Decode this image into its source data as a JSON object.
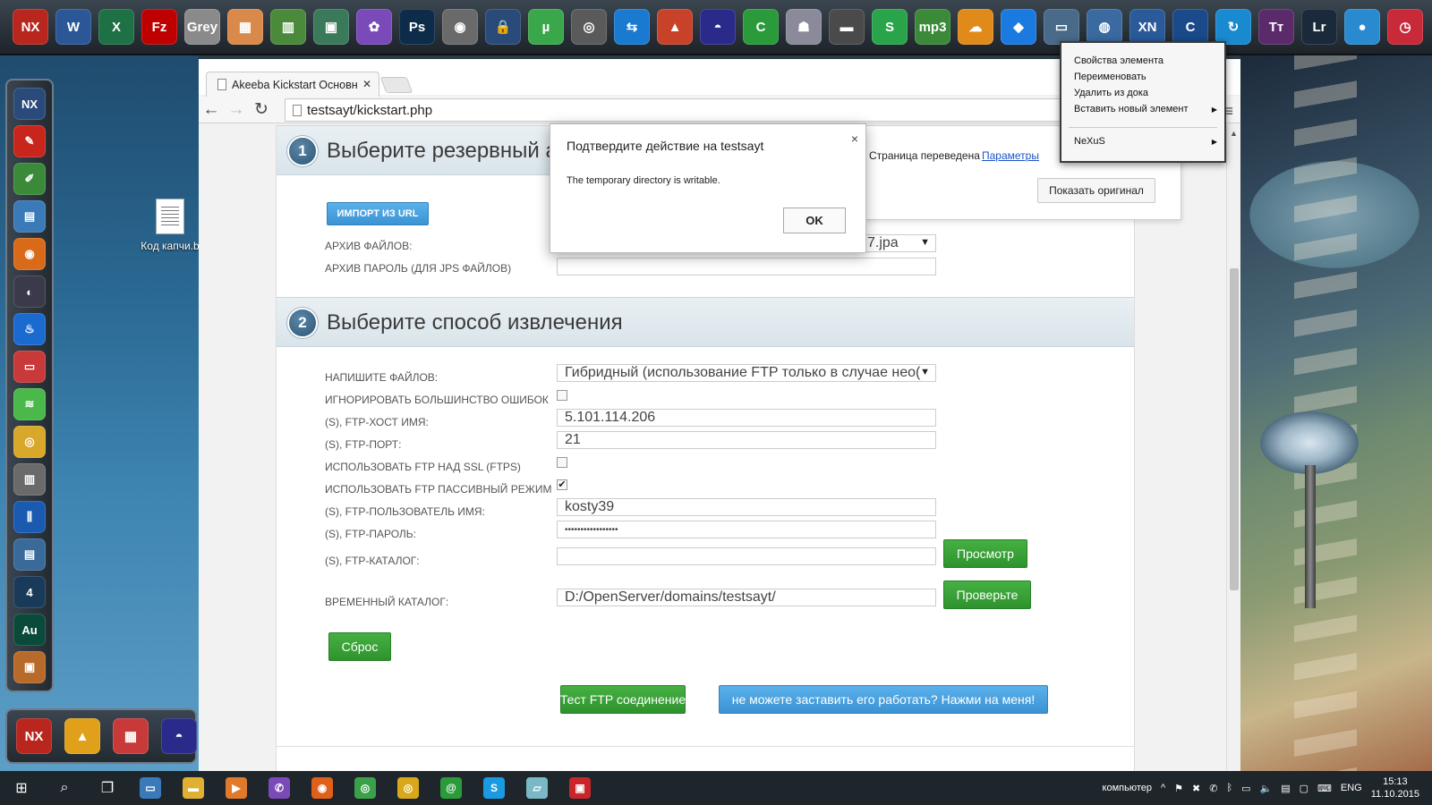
{
  "desktop": {
    "file_label": "Код капчи.b"
  },
  "top_dock": {
    "icons": [
      {
        "name": "nexus-icon",
        "glyph": "NX",
        "color": "#b8261d"
      },
      {
        "name": "word-icon",
        "glyph": "W",
        "color": "#2b5797"
      },
      {
        "name": "excel-icon",
        "glyph": "X",
        "color": "#1e7145"
      },
      {
        "name": "filezilla-icon",
        "glyph": "Fz",
        "color": "#bf0000"
      },
      {
        "name": "grey-icon",
        "glyph": "Grey",
        "color": "#8a8a8a"
      },
      {
        "name": "archive-icon",
        "glyph": "▦",
        "color": "#d98a4a"
      },
      {
        "name": "calculator-icon",
        "glyph": "▥",
        "color": "#4a8a3a"
      },
      {
        "name": "photo-viewer-icon",
        "glyph": "▣",
        "color": "#3a7a5a"
      },
      {
        "name": "picasa-icon",
        "glyph": "✿",
        "color": "#7a4ab8"
      },
      {
        "name": "photoshop-icon",
        "glyph": "Ps",
        "color": "#0c2c4a"
      },
      {
        "name": "disc-icon",
        "glyph": "◉",
        "color": "#6a6a6a"
      },
      {
        "name": "lock-icon",
        "glyph": "🔒",
        "color": "#2a4a7a"
      },
      {
        "name": "utorrent-icon",
        "glyph": "µ",
        "color": "#3aa84a"
      },
      {
        "name": "webcam-icon",
        "glyph": "◎",
        "color": "#5a5a5a"
      },
      {
        "name": "teamviewer-icon",
        "glyph": "⇆",
        "color": "#1a7ad0"
      },
      {
        "name": "antivirus-icon",
        "glyph": "▲",
        "color": "#c8422a"
      },
      {
        "name": "helmet-icon",
        "glyph": "◓",
        "color": "#2a2a8a"
      },
      {
        "name": "camtasia-icon",
        "glyph": "C",
        "color": "#2a9a3a"
      },
      {
        "name": "robot-icon",
        "glyph": "☗",
        "color": "#8a8a9a"
      },
      {
        "name": "memory-icon",
        "glyph": "▬",
        "color": "#4a4a4a"
      },
      {
        "name": "skype-s-icon",
        "glyph": "S",
        "color": "#2aa44a"
      },
      {
        "name": "mp3-cutter-icon",
        "glyph": "mp3",
        "color": "#3a8a3a"
      },
      {
        "name": "weather-icon",
        "glyph": "☁",
        "color": "#e08a1a"
      },
      {
        "name": "dropbox-icon",
        "glyph": "◆",
        "color": "#1a7ae0"
      },
      {
        "name": "screen-icon",
        "glyph": "▭",
        "color": "#4a6a8a"
      },
      {
        "name": "globe-icon",
        "glyph": "◍",
        "color": "#3a6aa0"
      },
      {
        "name": "xn-icon",
        "glyph": "XN",
        "color": "#2a5a9a"
      },
      {
        "name": "browser-c-icon",
        "glyph": "C",
        "color": "#1a4a8a"
      },
      {
        "name": "sync-icon",
        "glyph": "↻",
        "color": "#1a8ad0"
      },
      {
        "name": "typora-icon",
        "glyph": "Tт",
        "color": "#5a2a6a"
      },
      {
        "name": "lightroom-icon",
        "glyph": "Lr",
        "color": "#1a2a3a"
      },
      {
        "name": "bubble-icon",
        "glyph": "●",
        "color": "#2a8ad0"
      },
      {
        "name": "alarm-clock-icon",
        "glyph": "◷",
        "color": "#c82a3a"
      }
    ]
  },
  "left_dock": {
    "icons": [
      {
        "name": "nexus-small-icon",
        "glyph": "NX",
        "color": "#2a4a7a"
      },
      {
        "name": "feather-icon",
        "glyph": "✎",
        "color": "#c8261d"
      },
      {
        "name": "notepad-icon",
        "glyph": "✐",
        "color": "#3a8a3a"
      },
      {
        "name": "landscape-icon",
        "glyph": "▤",
        "color": "#3a7ab8"
      },
      {
        "name": "eye-icon",
        "glyph": "◉",
        "color": "#d86a1a"
      },
      {
        "name": "eye-dark-icon",
        "glyph": "◐",
        "color": "#3a3a4a"
      },
      {
        "name": "fire-icon",
        "glyph": "♨",
        "color": "#1a6ad0"
      },
      {
        "name": "card-icon",
        "glyph": "▭",
        "color": "#c83a3a"
      },
      {
        "name": "wifi-icon",
        "glyph": "≋",
        "color": "#4ab84a"
      },
      {
        "name": "coins-icon",
        "glyph": "◎",
        "color": "#d8a82a"
      },
      {
        "name": "server-icon",
        "glyph": "▥",
        "color": "#6a6a6a"
      },
      {
        "name": "equalizer-icon",
        "glyph": "⫼",
        "color": "#1a5ab0"
      },
      {
        "name": "documents-icon",
        "glyph": "▤",
        "color": "#3a6a9a"
      },
      {
        "name": "four-icon",
        "glyph": "4",
        "color": "#1a3a5a"
      },
      {
        "name": "audition-icon",
        "glyph": "Au",
        "color": "#0a4a3a"
      },
      {
        "name": "toolbox-icon",
        "glyph": "▣",
        "color": "#b86a2a"
      }
    ]
  },
  "bottom_dock": {
    "icons": [
      {
        "name": "nexus-bottom-icon",
        "glyph": "NX",
        "color": "#b8261d"
      },
      {
        "name": "triangle-icon",
        "glyph": "▲",
        "color": "#e0a01a"
      },
      {
        "name": "cube-icon",
        "glyph": "▦",
        "color": "#c83a3a"
      },
      {
        "name": "helmet-bottom-icon",
        "glyph": "◓",
        "color": "#2a2a8a"
      }
    ]
  },
  "browser": {
    "tab_title": "Akeeba Kickstart Основн",
    "url": "testsayt/kickstart.php"
  },
  "page": {
    "section1": {
      "number": "1",
      "title": "Выберите резервный а",
      "import_button": "ИМПОРТ ИЗ URL",
      "archive_label": "АРХИВ ФАЙЛОВ:",
      "archive_value": "7.jpa",
      "password_label": "АРХИВ ПАРОЛЬ (ДЛЯ JPS ФАЙЛОВ)"
    },
    "section2": {
      "number": "2",
      "title": "Выберите способ извлечения",
      "write_label": "НАПИШИТЕ ФАЙЛОВ:",
      "write_value": "Гибридный (использование FTP только в случае нео(",
      "ignore_label": "ИГНОРИРОВАТЬ БОЛЬШИНСТВО ОШИБОК",
      "ftp_host_label": "(S), FTP-ХОСТ ИМЯ:",
      "ftp_host_value": "5.101.114.206",
      "ftp_port_label": "(S), FTP-ПОРТ:",
      "ftp_port_value": "21",
      "ftps_label": "ИСПОЛЬЗОВАТЬ FTP НАД SSL (FTPS)",
      "passive_label": "ИСПОЛЬЗОВАТЬ FTP ПАССИВНЫЙ РЕЖИМ",
      "passive_check": "✔",
      "ftp_user_label": "(S), FTP-ПОЛЬЗОВАТЕЛЬ ИМЯ:",
      "ftp_user_value": "kosty39",
      "ftp_pass_label": "(S), FTP-ПАРОЛЬ:",
      "ftp_pass_value": "•••••••••••••••••",
      "ftp_dir_label": "(S), FTP-КАТАЛОГ:",
      "browse_button": "Просмотр",
      "temp_label": "ВРЕМЕННЫЙ КАТАЛОГ:",
      "temp_value": "D:/OpenServer/domains/testsayt/",
      "check_button": "Проверьте",
      "reset_button": "Сброс",
      "test_ftp_button": "Тест FTP соединение",
      "help_button": "не можете заставить его работать? Нажми на меня!"
    }
  },
  "translate_bar": {
    "text": "Страница переведена",
    "link": "Параметры",
    "show_original": "Показать оригинал"
  },
  "dialog": {
    "title": "Подтвердите действие на testsayt",
    "message": "The temporary directory is writable.",
    "ok": "OK",
    "close": "×"
  },
  "context_menu": {
    "items": [
      "Свойства элемента",
      "Переименовать",
      "Удалить из дока",
      "Вставить новый элемент",
      "NeXuS"
    ]
  },
  "taskbar": {
    "tray_label": "компьютер",
    "language": "ENG",
    "time": "15:13",
    "date": "11.10.2015"
  }
}
